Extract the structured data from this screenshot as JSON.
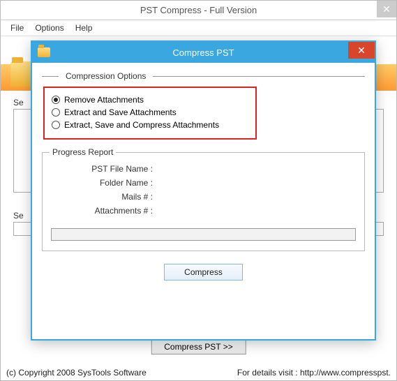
{
  "main": {
    "title": "PST Compress - Full Version",
    "menu": {
      "file": "File",
      "options": "Options",
      "help": "Help"
    },
    "bg_select_label": "Se",
    "bg_select_label2": "Se",
    "compress_btn": "Compress PST >>",
    "footer_left": "(c) Copyright 2008 SysTools Software",
    "footer_right": "For details visit : http://www.compresspst."
  },
  "dialog": {
    "title": "Compress PST",
    "section_label": "Compression Options",
    "options": {
      "remove": "Remove Attachments",
      "extract": "Extract and Save Attachments",
      "extract_compress": "Extract, Save and Compress Attachments",
      "selected": "remove"
    },
    "progress": {
      "legend": "Progress Report",
      "pst_label": "PST File Name :",
      "folder_label": "Folder Name :",
      "mails_label": "Mails # :",
      "attach_label": "Attachments # :",
      "pst_value": "",
      "folder_value": "",
      "mails_value": "",
      "attach_value": ""
    },
    "compress_btn": "Compress"
  }
}
